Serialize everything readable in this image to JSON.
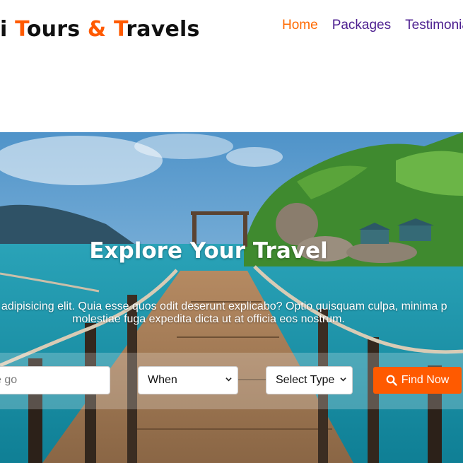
{
  "brand": {
    "part_1": "i ",
    "letter_t1": "T",
    "part_2": "ours ",
    "ampersand": "&",
    "part_3": " ",
    "letter_t2": "T",
    "part_4": "ravels",
    "accent_color": "#ff5a00"
  },
  "nav": {
    "home": "Home",
    "packages": "Packages",
    "testimonials": "Testimonia"
  },
  "hero": {
    "title": "Explore Your Travel",
    "text_line_1": "ctetur adipisicing elit. Quia esse quos odit deserunt explicabo? Optio quisquam culpa, minima p",
    "text_line_2": "molestiae fuga expedita dicta ut at officia eos nostrum."
  },
  "search": {
    "where_placeholder": "e go",
    "when_value": "When",
    "type_value": "Select Type",
    "find_label": "Find Now",
    "find_icon": "search-icon",
    "button_color": "#ff5a00"
  }
}
